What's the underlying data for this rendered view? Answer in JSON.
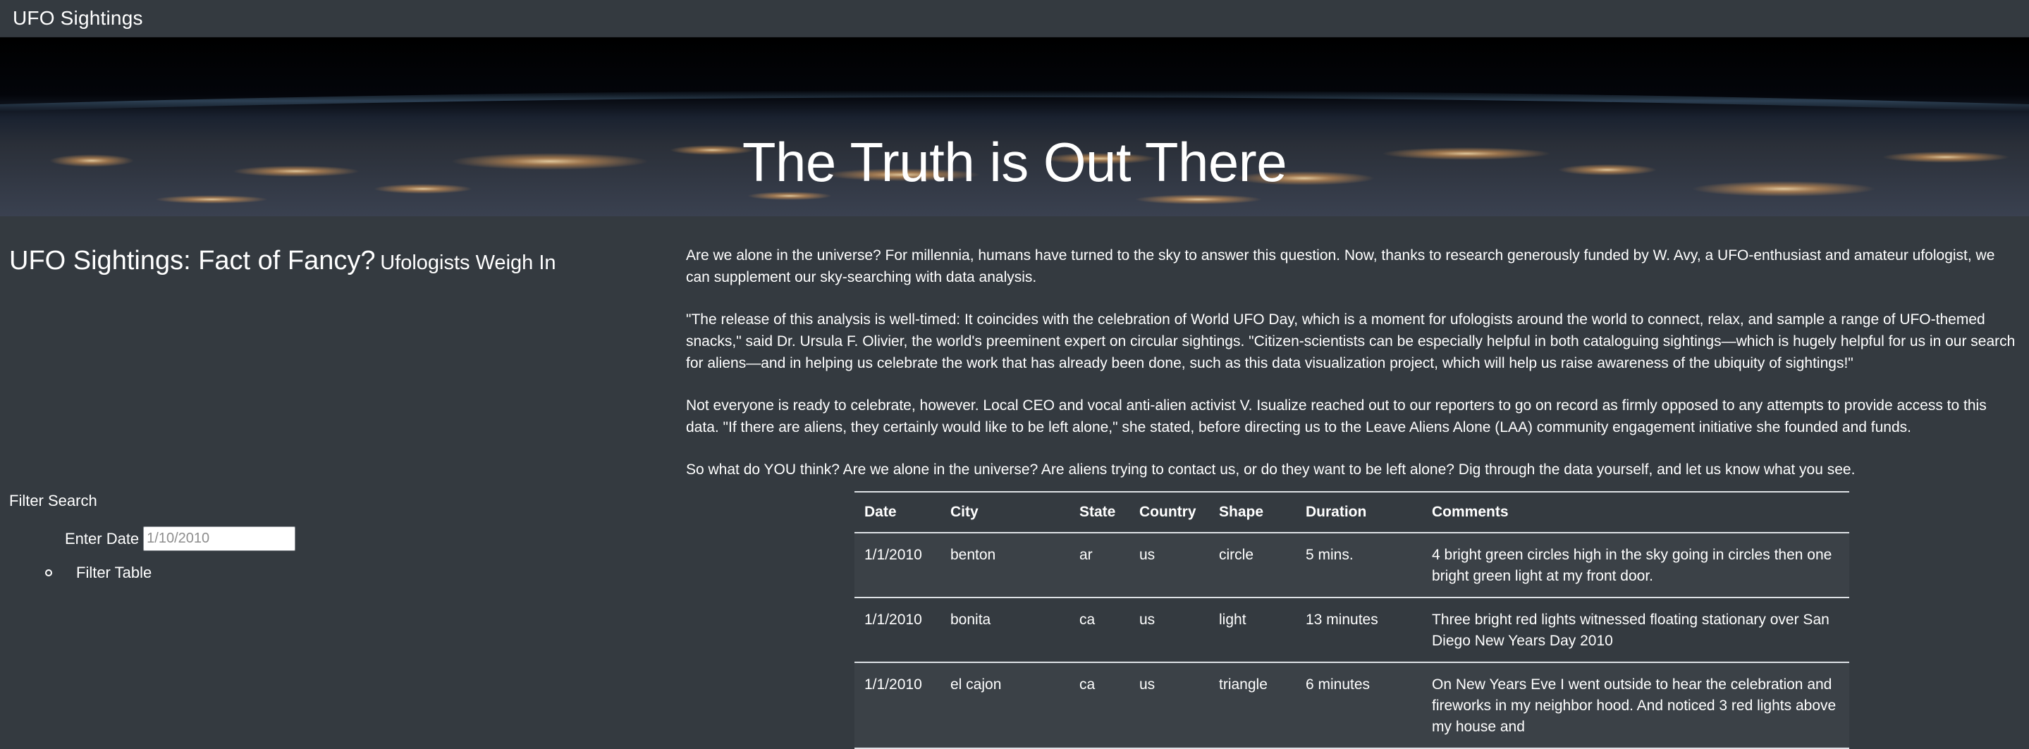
{
  "navbar": {
    "brand": "UFO Sightings"
  },
  "hero": {
    "title": "The Truth is Out There"
  },
  "article": {
    "title_main": "UFO Sightings: Fact of Fancy?",
    "title_sub": "Ufologists Weigh In",
    "paragraphs": [
      "Are we alone in the universe? For millennia, humans have turned to the sky to answer this question. Now, thanks to research generously funded by W. Avy, a UFO-enthusiast and amateur ufologist, we can supplement our sky-searching with data analysis.",
      "\"The release of this analysis is well-timed: It coincides with the celebration of World UFO Day, which is a moment for ufologists around the world to connect, relax, and sample a range of UFO-themed snacks,\" said Dr. Ursula F. Olivier, the world's preeminent expert on circular sightings. \"Citizen-scientists can be especially helpful in both cataloguing sightings—which is hugely helpful for us in our search for aliens—and in helping us celebrate the work that has already been done, such as this data visualization project, which will help us raise awareness of the ubiquity of sightings!\"",
      "Not everyone is ready to celebrate, however. Local CEO and vocal anti-alien activist V. Isualize reached out to our reporters to go on record as firmly opposed to any attempts to provide access to this data. \"If there are aliens, they certainly would like to be left alone,\" she stated, before directing us to the Leave Aliens Alone (LAA) community engagement initiative she founded and funds.",
      "So what do YOU think? Are we alone in the universe? Are aliens trying to contact us, or do they want to be left alone? Dig through the data yourself, and let us know what you see."
    ]
  },
  "filters": {
    "heading": "Filter Search",
    "date_label": "Enter Date",
    "date_placeholder": "1/10/2010",
    "date_value": "",
    "button_label": "Filter Table"
  },
  "table": {
    "headers": {
      "date": "Date",
      "city": "City",
      "state": "State",
      "country": "Country",
      "shape": "Shape",
      "duration": "Duration",
      "comments": "Comments"
    },
    "rows": [
      {
        "date": "1/1/2010",
        "city": "benton",
        "state": "ar",
        "country": "us",
        "shape": "circle",
        "duration": "5 mins.",
        "comments": "4 bright green circles high in the sky going in circles then one bright green light at my front door."
      },
      {
        "date": "1/1/2010",
        "city": "bonita",
        "state": "ca",
        "country": "us",
        "shape": "light",
        "duration": "13 minutes",
        "comments": "Three bright red lights witnessed floating stationary over San Diego New Years Day 2010"
      },
      {
        "date": "1/1/2010",
        "city": "el cajon",
        "state": "ca",
        "country": "us",
        "shape": "triangle",
        "duration": "6 minutes",
        "comments": "On New Years Eve I went outside to hear the celebration and fireworks in my neighbor hood. And noticed 3 red lights above my house and"
      }
    ]
  },
  "colors": {
    "page_background": "#343a40",
    "row_stripe": "#3b4147",
    "rule": "#dee2e6",
    "text": "#ffffff"
  }
}
